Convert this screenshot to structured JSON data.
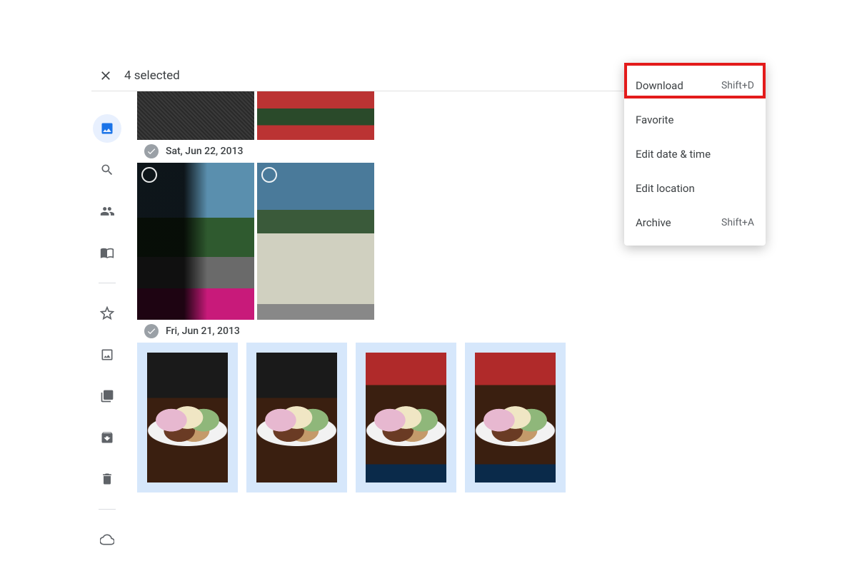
{
  "topbar": {
    "selection_label": "4 selected"
  },
  "dates": {
    "group0": "Sat, Jun 22, 2013",
    "group1": "Fri, Jun 21, 2013"
  },
  "menu": {
    "download": {
      "label": "Download",
      "shortcut": "Shift+D"
    },
    "favorite": {
      "label": "Favorite"
    },
    "edit_date": {
      "label": "Edit date & time"
    },
    "edit_location": {
      "label": "Edit location"
    },
    "archive": {
      "label": "Archive",
      "shortcut": "Shift+A"
    }
  },
  "sidebar": {
    "icons": [
      "photos",
      "search",
      "sharing",
      "memories",
      "favorites",
      "albums",
      "utilities",
      "archive",
      "trash",
      "storage"
    ]
  }
}
